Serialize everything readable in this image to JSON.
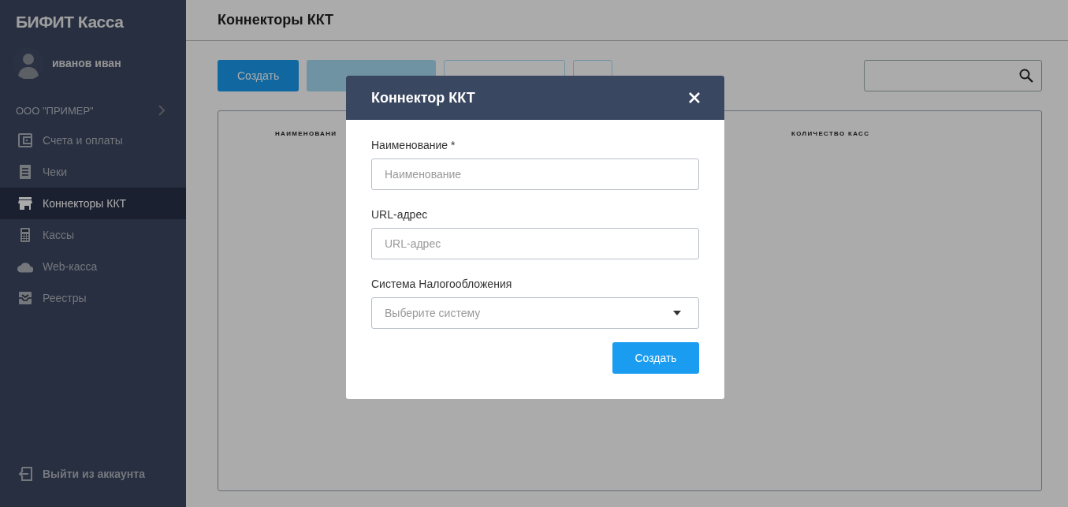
{
  "app": {
    "title": "БИФИТ Касса"
  },
  "user": {
    "name": "иванов иван"
  },
  "organization": {
    "name": "ООО \"ПРИМЕР\""
  },
  "sidebar": {
    "items": [
      {
        "label": "Счета и оплаты",
        "selected": false
      },
      {
        "label": "Чеки",
        "selected": false
      },
      {
        "label": "Коннекторы ККТ",
        "selected": true
      },
      {
        "label": "Кассы",
        "selected": false
      },
      {
        "label": "Web-касса",
        "selected": false
      },
      {
        "label": "Реестры",
        "selected": false
      }
    ],
    "logout": "Выйти из аккаунта"
  },
  "page": {
    "title": "Коннекторы ККТ"
  },
  "toolbar": {
    "buttons": [
      {
        "label": "Создать",
        "kind": "primary",
        "disabled": false
      },
      {
        "kind": "primary",
        "disabled": true
      },
      {
        "kind": "outline",
        "disabled": true
      },
      {
        "kind": "trash",
        "disabled": true
      }
    ]
  },
  "table": {
    "columns": [
      "НАИМЕНОВАНИ",
      "КОЛИЧЕСТВО КАСС"
    ]
  },
  "dialog": {
    "title": "Коннектор ККТ",
    "fields": [
      {
        "label": "Наименование *",
        "placeholder": "Наименование",
        "kind": "text"
      },
      {
        "label": "URL-адрес",
        "placeholder": "URL-адрес",
        "kind": "text"
      },
      {
        "label": "Система Налогообложения",
        "placeholder": "Выберите систему",
        "kind": "select"
      }
    ],
    "submit": "Создать"
  }
}
